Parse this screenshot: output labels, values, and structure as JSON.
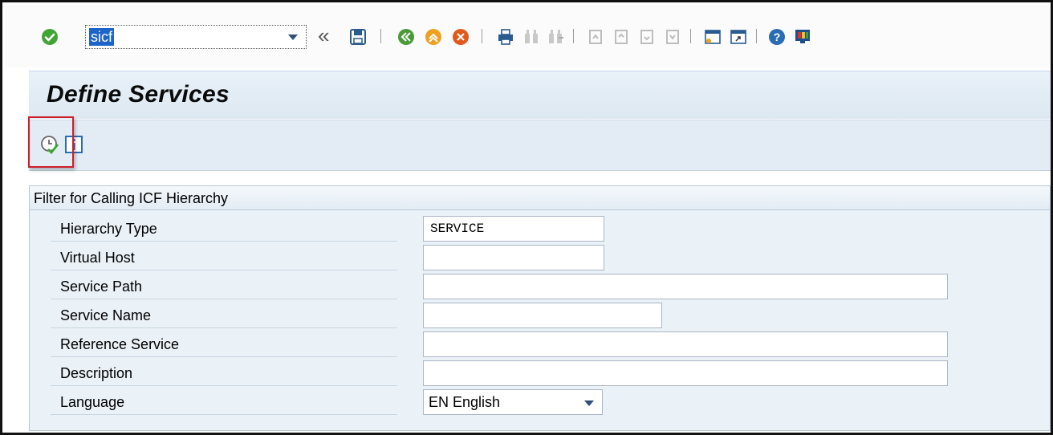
{
  "toolbar": {
    "command_field_value": "sicf",
    "expand_symbol": "«",
    "accent_color": "#1c64c9"
  },
  "page": {
    "title": "Define Services"
  },
  "app_toolbar": {
    "execute_icon": "execute-clock-check-icon",
    "info_icon": "information-icon",
    "highlight_color": "#cc1f2a"
  },
  "filter": {
    "heading": "Filter for Calling ICF Hierarchy",
    "fields": [
      {
        "label": "Hierarchy Type",
        "value": "SERVICE"
      },
      {
        "label": "Virtual Host",
        "value": ""
      },
      {
        "label": "Service Path",
        "value": ""
      },
      {
        "label": "Service Name",
        "value": ""
      },
      {
        "label": "Reference Service",
        "value": ""
      },
      {
        "label": "Description",
        "value": ""
      },
      {
        "label": "Language",
        "value": "EN English"
      }
    ]
  }
}
